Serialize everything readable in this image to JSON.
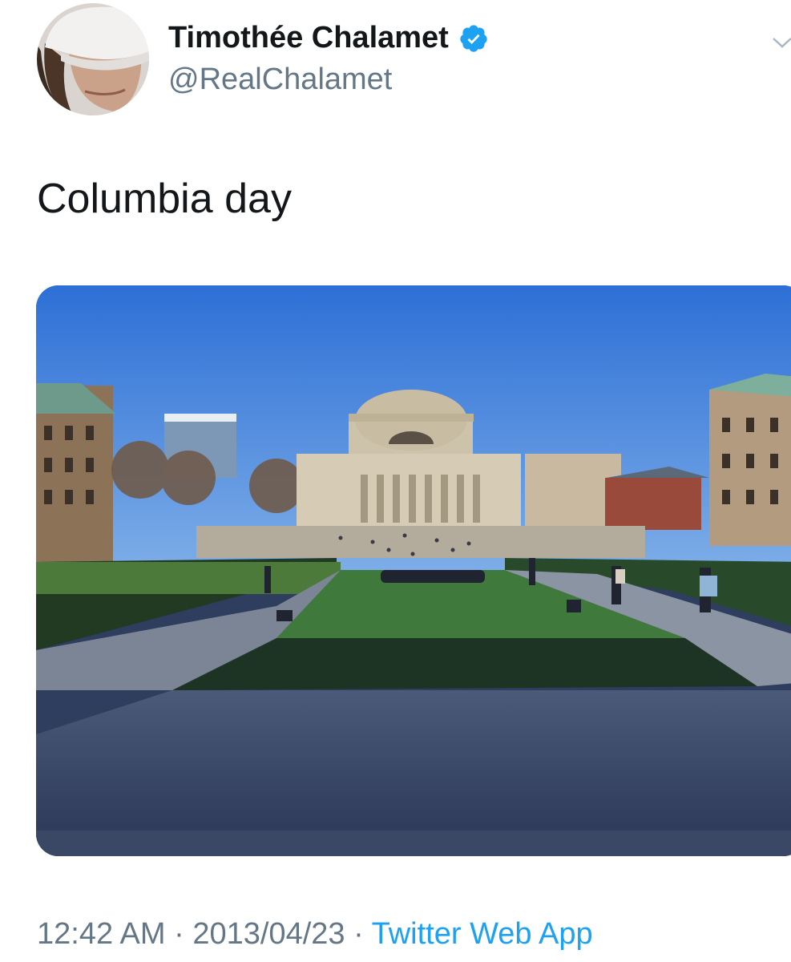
{
  "tweet": {
    "author": {
      "display_name": "Timothée Chalamet",
      "handle": "@RealChalamet",
      "verified": true,
      "verified_icon": "verified-badge-icon",
      "verified_color": "#1da1f2"
    },
    "text": "Columbia day",
    "media": {
      "type": "photo"
    },
    "meta": {
      "time": "12:42 AM",
      "separator": "·",
      "date": "2013/04/23",
      "source": "Twitter Web App"
    },
    "menu_icon": "chevron-down-icon"
  },
  "colors": {
    "text_primary": "#14171a",
    "text_secondary": "#657786",
    "link": "#1da1f2"
  }
}
